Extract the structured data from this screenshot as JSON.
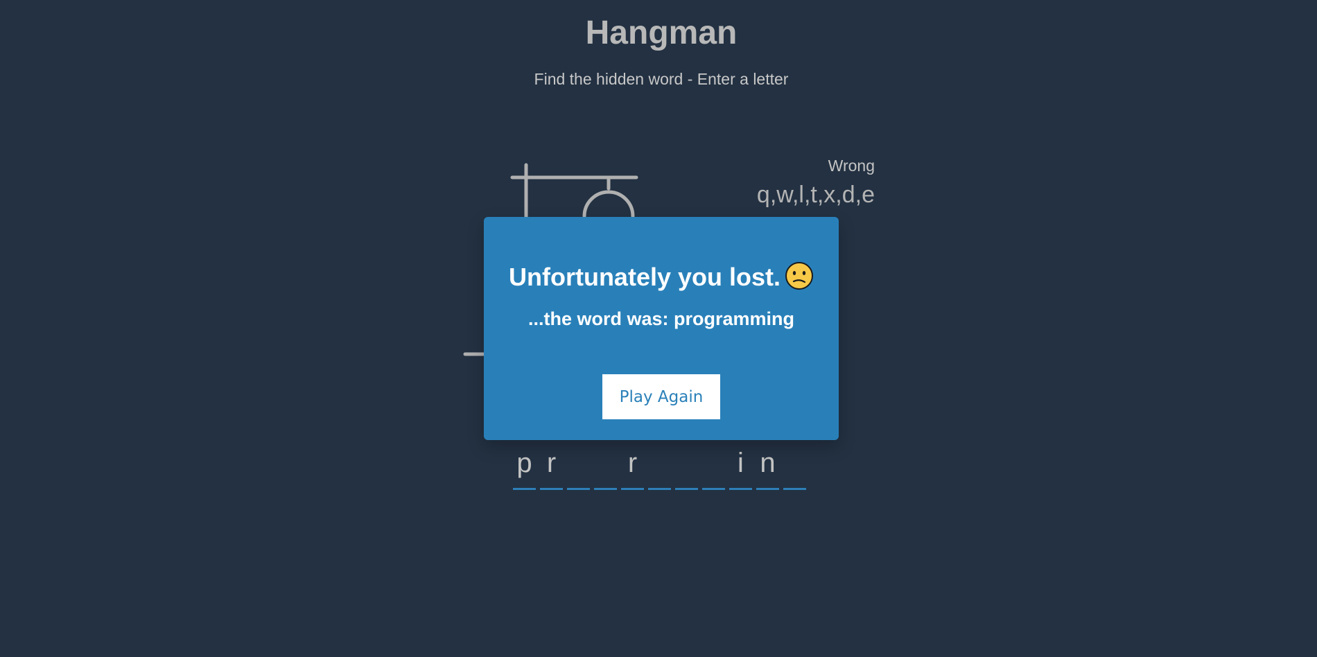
{
  "header": {
    "title": "Hangman",
    "subtitle": "Find the hidden word - Enter a letter"
  },
  "wrong": {
    "label": "Wrong",
    "letters": "q,w,l,t,x,d,e"
  },
  "word": {
    "slots": [
      "p",
      "r",
      "",
      "",
      "r",
      "",
      "",
      "",
      "i",
      "n",
      ""
    ]
  },
  "popup": {
    "heading": "Unfortunately you lost.",
    "emoji_icon": "confused-face-icon",
    "word_reveal": "...the word was: programming",
    "button_label": "Play Again"
  },
  "colors": {
    "background": "#233142",
    "popup": "#2980b9",
    "accent": "#2e7fb8"
  }
}
